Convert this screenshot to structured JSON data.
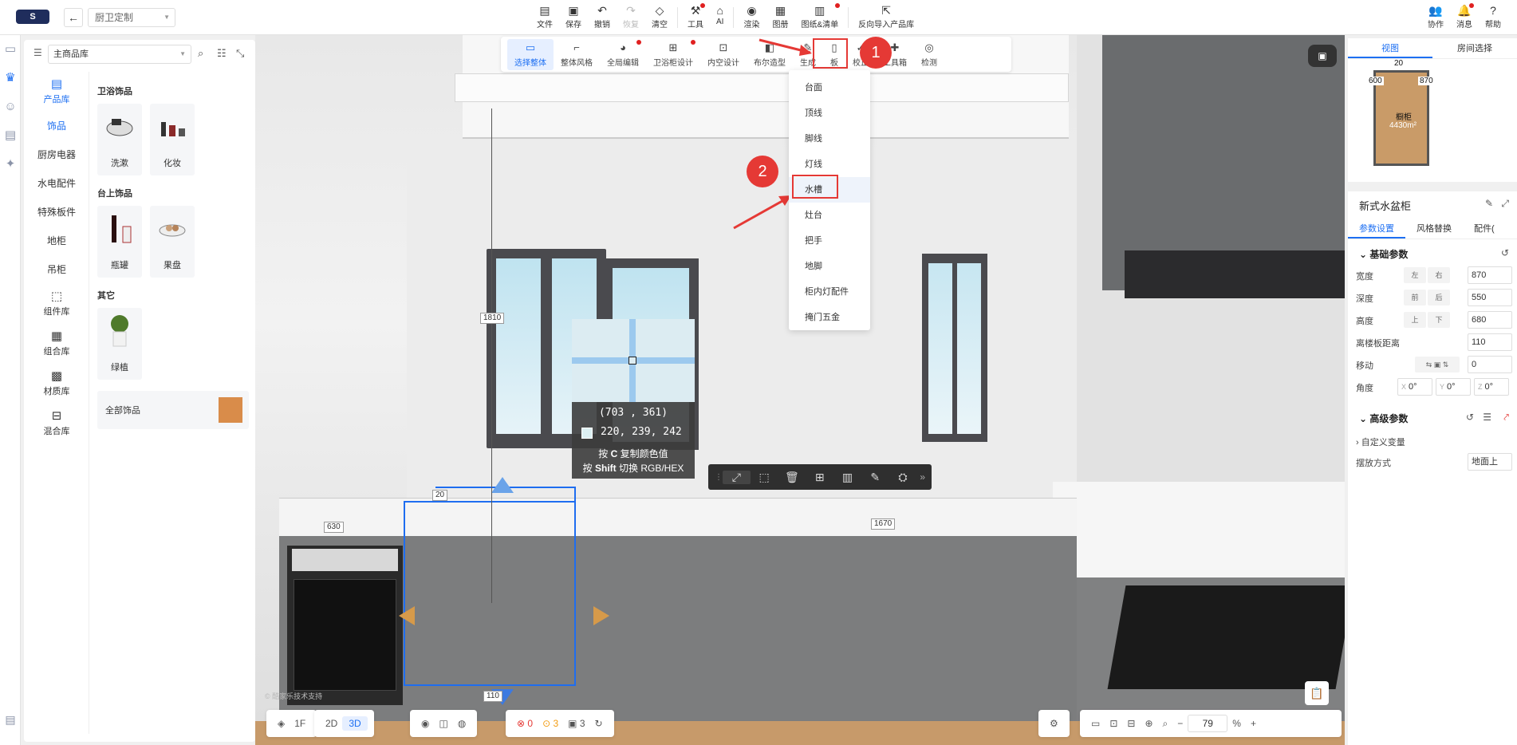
{
  "header": {
    "project_name": "厨卫定制",
    "tools": [
      {
        "label": "文件",
        "icon": "file-icon"
      },
      {
        "label": "保存",
        "icon": "save-icon"
      },
      {
        "label": "撤销",
        "icon": "undo-icon"
      },
      {
        "label": "恢复",
        "icon": "redo-icon"
      },
      {
        "label": "清空",
        "icon": "clear-icon"
      },
      {
        "label": "工具",
        "icon": "tool-icon"
      },
      {
        "label": "AI",
        "icon": "ai-icon"
      },
      {
        "label": "渲染",
        "icon": "render-icon"
      },
      {
        "label": "图册",
        "icon": "album-icon"
      },
      {
        "label": "图纸&清单",
        "icon": "drawing-icon"
      },
      {
        "label": "反向导入产品库",
        "icon": "import-icon"
      }
    ],
    "right_tools": [
      {
        "label": "协作",
        "icon": "collab-icon"
      },
      {
        "label": "消息",
        "icon": "bell-icon"
      },
      {
        "label": "帮助",
        "icon": "help-icon"
      }
    ]
  },
  "left_panel": {
    "library_select": "主商品库",
    "categories": [
      "饰品",
      "厨房电器",
      "水电配件",
      "特殊板件",
      "地柜",
      "吊柜"
    ],
    "libraries": [
      {
        "label": "产品库",
        "icon": "product-lib-icon"
      },
      {
        "label": "组件库",
        "icon": "component-lib-icon"
      },
      {
        "label": "组合库",
        "icon": "combo-lib-icon"
      },
      {
        "label": "材质库",
        "icon": "material-lib-icon"
      },
      {
        "label": "混合库",
        "icon": "mixed-lib-icon"
      }
    ],
    "sections": [
      {
        "title": "卫浴饰品",
        "items": [
          "洗漱",
          "化妆"
        ]
      },
      {
        "title": "台上饰品",
        "items": [
          "瓶罐",
          "果盘"
        ]
      },
      {
        "title": "其它",
        "items": [
          "绿植"
        ]
      }
    ],
    "all_items_label": "全部饰品"
  },
  "view_toolbar": {
    "items": [
      {
        "label": "选择整体"
      },
      {
        "label": "整体风格"
      },
      {
        "label": "全局编辑"
      },
      {
        "label": "卫浴柜设计"
      },
      {
        "label": "内空设计"
      },
      {
        "label": "布尔造型"
      },
      {
        "label": "生成"
      },
      {
        "label": "板"
      },
      {
        "label": "校正"
      },
      {
        "label": "工具箱"
      },
      {
        "label": "检测"
      }
    ]
  },
  "generate_menu": {
    "items": [
      "台面",
      "顶线",
      "脚线",
      "灯线",
      "水槽",
      "灶台",
      "把手",
      "地脚",
      "柜内灯配件",
      "掩门五金"
    ]
  },
  "annotations": {
    "step1": "1",
    "step2": "2"
  },
  "color_picker": {
    "coord": "(703  , 361)",
    "rgb": "220, 239, 242",
    "hint_copy_prefix": "按",
    "hint_copy_key": "C",
    "hint_copy_suffix": "复制颜色值",
    "hint_switch_prefix": "按",
    "hint_switch_key": "Shift",
    "hint_switch_suffix": "切换 RGB/HEX"
  },
  "dimensions": {
    "d1810": "1810",
    "d20": "20",
    "d630": "630",
    "d1670": "1670",
    "d110": "110"
  },
  "watermark": "© 酷家乐技术支持",
  "bottom": {
    "floor": "1F",
    "mode_2d": "2D",
    "mode_3d": "3D",
    "errors": "0",
    "warnings": "3",
    "layers": "3",
    "zoom": "79",
    "zoom_unit": "%"
  },
  "minimap": {
    "tabs": [
      "视图",
      "房间选择"
    ],
    "dim_top": "20",
    "dim_left": "600",
    "dim_right": "870",
    "room_name": "橱柜",
    "room_area": "4430",
    "area_unit": "m²"
  },
  "properties": {
    "title": "新式水盆柜",
    "tabs": [
      "参数设置",
      "风格替换",
      "配件("
    ],
    "basic_section": "基础参数",
    "width_label": "宽度",
    "width_lock_a": "左",
    "width_lock_b": "右",
    "width_value": "870",
    "depth_label": "深度",
    "depth_lock_a": "前",
    "depth_lock_b": "后",
    "depth_value": "550",
    "height_label": "高度",
    "height_lock_a": "上",
    "height_lock_b": "下",
    "height_value": "680",
    "floor_dist_label": "离楼板距离",
    "floor_dist_value": "110",
    "move_label": "移动",
    "move_value": "0",
    "angle_label": "角度",
    "angle_x": "0°",
    "angle_y": "0°",
    "angle_z": "0°",
    "advanced_section": "高级参数",
    "custom_var_label": "自定义变量",
    "placement_label": "摆放方式",
    "placement_value": "地面上"
  }
}
